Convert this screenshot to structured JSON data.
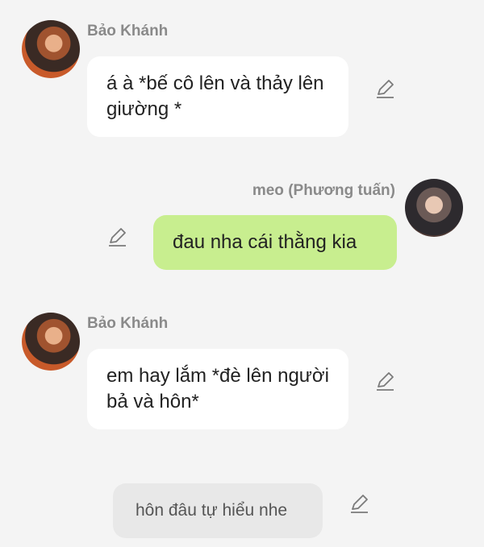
{
  "messages": [
    {
      "sender": "Bảo Khánh",
      "text": "á à *bế cô lên và thảy lên giường *"
    },
    {
      "sender": "meo (Phương tuấn)",
      "text": "đau nha cái thằng kia"
    },
    {
      "sender": "Bảo Khánh",
      "text": "em hay lắm *đè lên người bả và hôn*"
    },
    {
      "text": "hôn đâu tự hiểu nhe"
    }
  ],
  "colors": {
    "background": "#f4f4f4",
    "incoming_bubble": "#ffffff",
    "outgoing_bubble": "#c8ee8f",
    "hint_bubble": "#e8e8e8"
  },
  "icons": [
    "avatar",
    "edit-icon"
  ]
}
